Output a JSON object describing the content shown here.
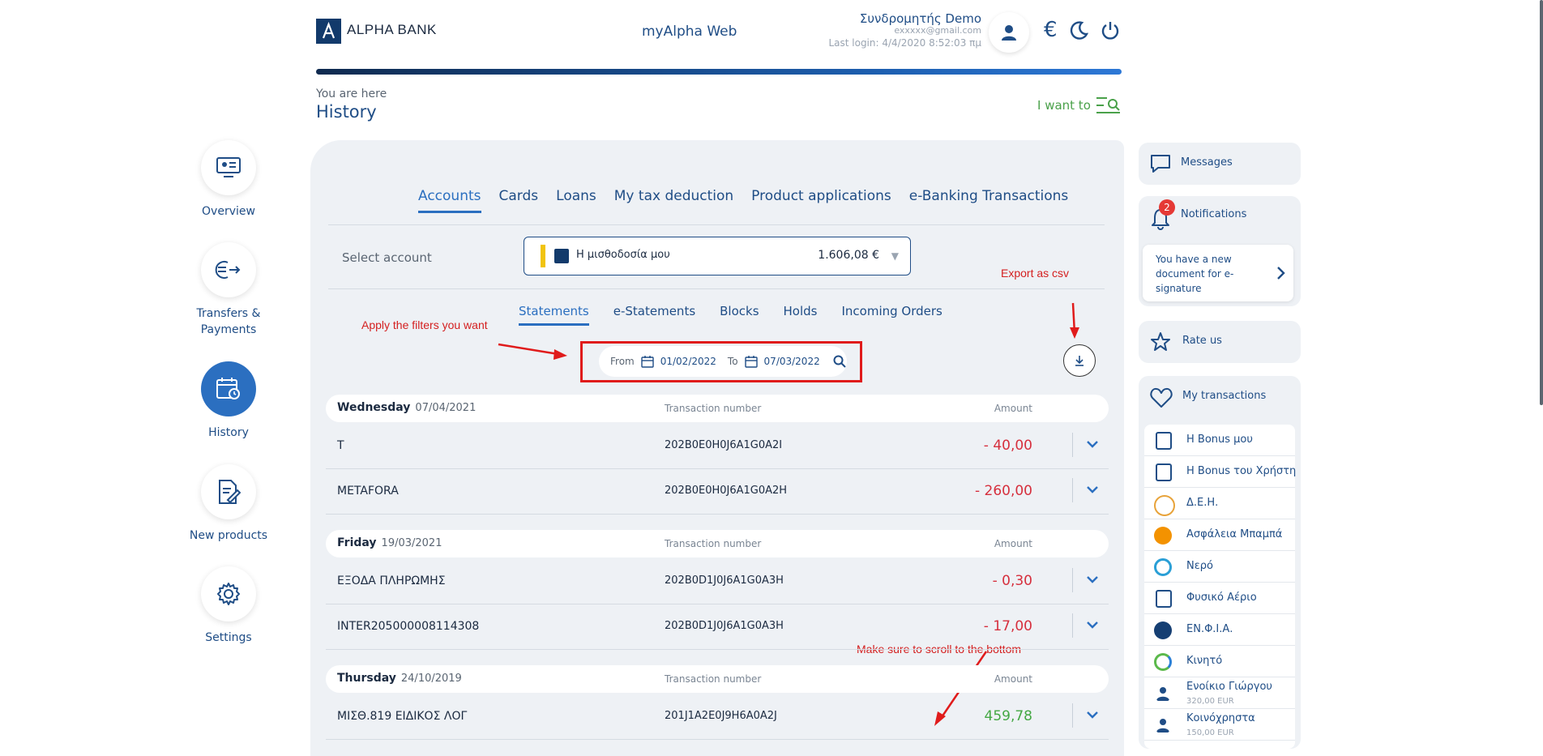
{
  "header": {
    "logo_text": "ALPHA BANK",
    "app_title": "myAlpha Web",
    "user_name": "Συνδρομητής Demo",
    "user_email": "exxxxx@gmail.com",
    "last_login": "Last login: 4/4/2020 8:52:03 πμ",
    "currency_symbol": "€"
  },
  "breadcrumb": {
    "you_are_here": "You are here",
    "page_title": "History",
    "i_want_to": "I want to"
  },
  "nav": [
    {
      "label": "Overview"
    },
    {
      "label": "Transfers & Payments"
    },
    {
      "label": "History"
    },
    {
      "label": "New products"
    },
    {
      "label": "Settings"
    }
  ],
  "tabs": [
    "Accounts",
    "Cards",
    "Loans",
    "My tax deduction",
    "Product applications",
    "e-Banking Transactions"
  ],
  "account": {
    "select_label": "Select account",
    "name": "Η μισθοδοσία μου",
    "balance": "1.606,08 €"
  },
  "subtabs": [
    "Statements",
    "e-Statements",
    "Blocks",
    "Holds",
    "Incoming Orders"
  ],
  "filter": {
    "from_label": "From",
    "from_date": "01/02/2022",
    "to_label": "To",
    "to_date": "07/03/2022"
  },
  "annotations": {
    "apply_filters": "Apply the filters you want",
    "export_csv": "Export as csv",
    "scroll_bottom": "Make sure to scroll to the bottom"
  },
  "columns": {
    "transaction_number": "Transaction number",
    "amount": "Amount"
  },
  "days": [
    {
      "day": "Wednesday",
      "date": "07/04/2021",
      "rows": [
        {
          "desc": "T",
          "number": "202B0E0H0J6A1G0A2I",
          "amount": "- 40,00",
          "type": "debit"
        },
        {
          "desc": "METAFORA",
          "number": "202B0E0H0J6A1G0A2H",
          "amount": "- 260,00",
          "type": "debit"
        }
      ]
    },
    {
      "day": "Friday",
      "date": "19/03/2021",
      "rows": [
        {
          "desc": "ΕΞΟΔΑ ΠΛΗΡΩΜΗΣ",
          "number": "202B0D1J0J6A1G0A3H",
          "amount": "- 0,30",
          "type": "debit"
        },
        {
          "desc": "INTER205000008114308",
          "number": "202B0D1J0J6A1G0A3H",
          "amount": "- 17,00",
          "type": "debit"
        }
      ]
    },
    {
      "day": "Thursday",
      "date": "24/10/2019",
      "rows": [
        {
          "desc": "ΜΙΣΘ.819 ΕΙΔΙΚΟΣ ΛΟΓ",
          "number": "201J1A2E0J9H6A0A2J",
          "amount": "459,78",
          "type": "credit"
        }
      ]
    }
  ],
  "right_panel": {
    "messages": "Messages",
    "notifications": "Notifications",
    "notification_count": "2",
    "notification_text": "You have a new document for e-signature",
    "rate_us": "Rate us",
    "my_transactions": "My transactions",
    "shortcuts": [
      {
        "label": "Η Bonus μου",
        "icon": "bonus-icon",
        "color": "#1f4d86"
      },
      {
        "label": "Η Bonus του Χρήστη",
        "icon": "bonus-icon",
        "color": "#1f4d86"
      },
      {
        "label": "Δ.Ε.Η.",
        "icon": "deh-icon",
        "color": "#e8a33a"
      },
      {
        "label": "Ασφάλεια Μπαμπά",
        "icon": "insurance-icon",
        "color": "#f39200"
      },
      {
        "label": "Νερό",
        "icon": "water-icon",
        "color": "#2a9fd6"
      },
      {
        "label": "Φυσικό Αέριο",
        "icon": "bonus-icon",
        "color": "#1f4d86"
      },
      {
        "label": "ΕΝ.Φ.Ι.Α.",
        "icon": "enfia-icon",
        "color": "#163f73"
      },
      {
        "label": "Κινητό",
        "icon": "mobile-icon",
        "color": "#5bb94b"
      },
      {
        "label": "Ενοίκιο Γιώργου",
        "sub": "320,00 EUR",
        "icon": "person-icon",
        "color": "#1f4d86"
      },
      {
        "label": "Κοινόχρηστα",
        "sub": "150,00 EUR",
        "icon": "person-icon",
        "color": "#1f4d86"
      }
    ]
  },
  "colors": {
    "debit": "#d62f3d",
    "credit": "#44a844",
    "primary": "#1f4d86",
    "accent": "#2b6fc0"
  }
}
